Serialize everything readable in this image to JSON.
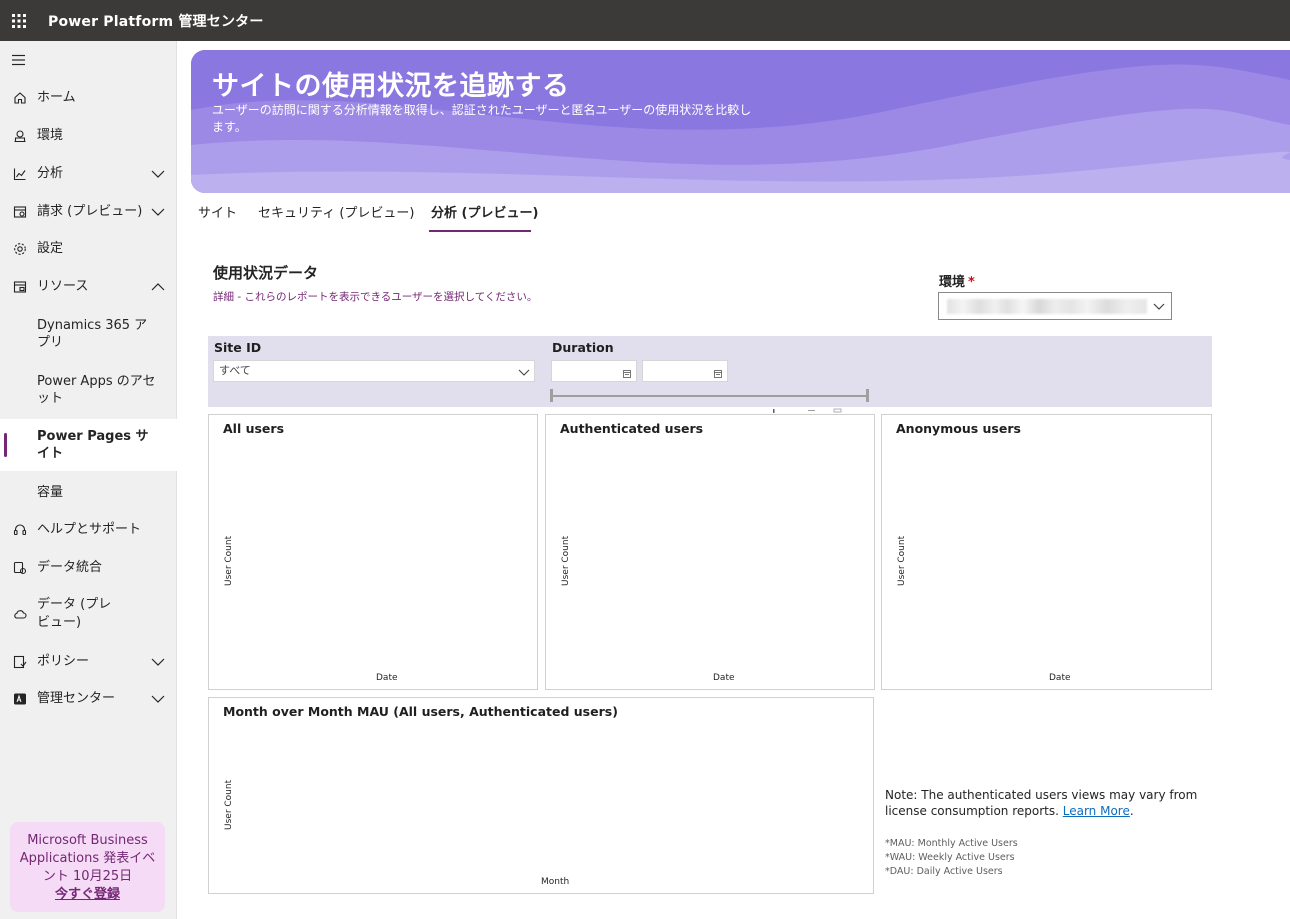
{
  "app": {
    "title": "Power Platform 管理センター"
  },
  "sidebar": {
    "items": [
      {
        "label": "ホーム",
        "icon": "home-icon"
      },
      {
        "label": "環境",
        "icon": "environments-icon"
      },
      {
        "label": "分析",
        "icon": "analytics-icon",
        "expandable": true,
        "expanded": false
      },
      {
        "label": "請求 (プレビュー)",
        "icon": "billing-icon",
        "expandable": true,
        "expanded": false
      },
      {
        "label": "設定",
        "icon": "settings-icon"
      },
      {
        "label": "リソース",
        "icon": "resources-icon",
        "expandable": true,
        "expanded": true
      },
      {
        "label": "Dynamics 365 アプリ",
        "sub": true
      },
      {
        "label": "Power Apps のアセット",
        "sub": true
      },
      {
        "label": "Power Pages サイト",
        "sub": true,
        "active": true
      },
      {
        "label": "容量",
        "sub": true
      },
      {
        "label": "ヘルプとサポート",
        "icon": "headset-icon"
      },
      {
        "label": "データ統合",
        "icon": "data-integration-icon"
      },
      {
        "label": "データ (プレビュー)",
        "icon": "cloud-data-icon"
      },
      {
        "label": "ポリシー",
        "icon": "policy-icon",
        "expandable": true,
        "expanded": false
      },
      {
        "label": "管理センター",
        "icon": "admin-center-icon",
        "expandable": true,
        "expanded": false
      }
    ],
    "promo": {
      "line1": "Microsoft Business",
      "line2": "Applications 発表イベ",
      "line3": "ント 10月25日",
      "link": "今すぐ登録"
    }
  },
  "hero": {
    "title": "サイトの使用状況を追跡する",
    "subtitle": "ユーザーの訪問に関する分析情報を取得し、認証されたユーザーと匿名ユーザーの使用状況を比較します。"
  },
  "tabs": [
    {
      "label": "サイト"
    },
    {
      "label": "セキュリティ (プレビュー)"
    },
    {
      "label": "分析 (プレビュー)",
      "active": true
    }
  ],
  "report": {
    "title": "使用状況データ",
    "description": "詳細 - これらのレポートを表示できるユーザーを選択してください。",
    "environment_label": "環境",
    "required_marker": "*",
    "filters": {
      "site_id_label": "Site ID",
      "site_id_value": "すべて",
      "duration_label": "Duration"
    },
    "charts": [
      {
        "title": "All users",
        "ylabel": "User Count",
        "xlabel": "Date"
      },
      {
        "title": "Authenticated users",
        "ylabel": "User Count",
        "xlabel": "Date"
      },
      {
        "title": "Anonymous users",
        "ylabel": "User Count",
        "xlabel": "Date"
      },
      {
        "title": "Month over Month MAU (All users, Authenticated users)",
        "ylabel": "User Count",
        "xlabel": "Month"
      }
    ],
    "note_text": "Note: The authenticated users views may vary from license consumption reports. ",
    "note_link": "Learn More",
    "note_end": ".",
    "abbreviations": [
      "*MAU: Monthly Active Users",
      "*WAU: Weekly Active Users",
      "*DAU: Daily Active Users"
    ]
  },
  "colors": {
    "brand": "#742774",
    "topbar": "#3b3a39",
    "hero": "#8c78e0",
    "filter_band": "#e1dfee"
  }
}
